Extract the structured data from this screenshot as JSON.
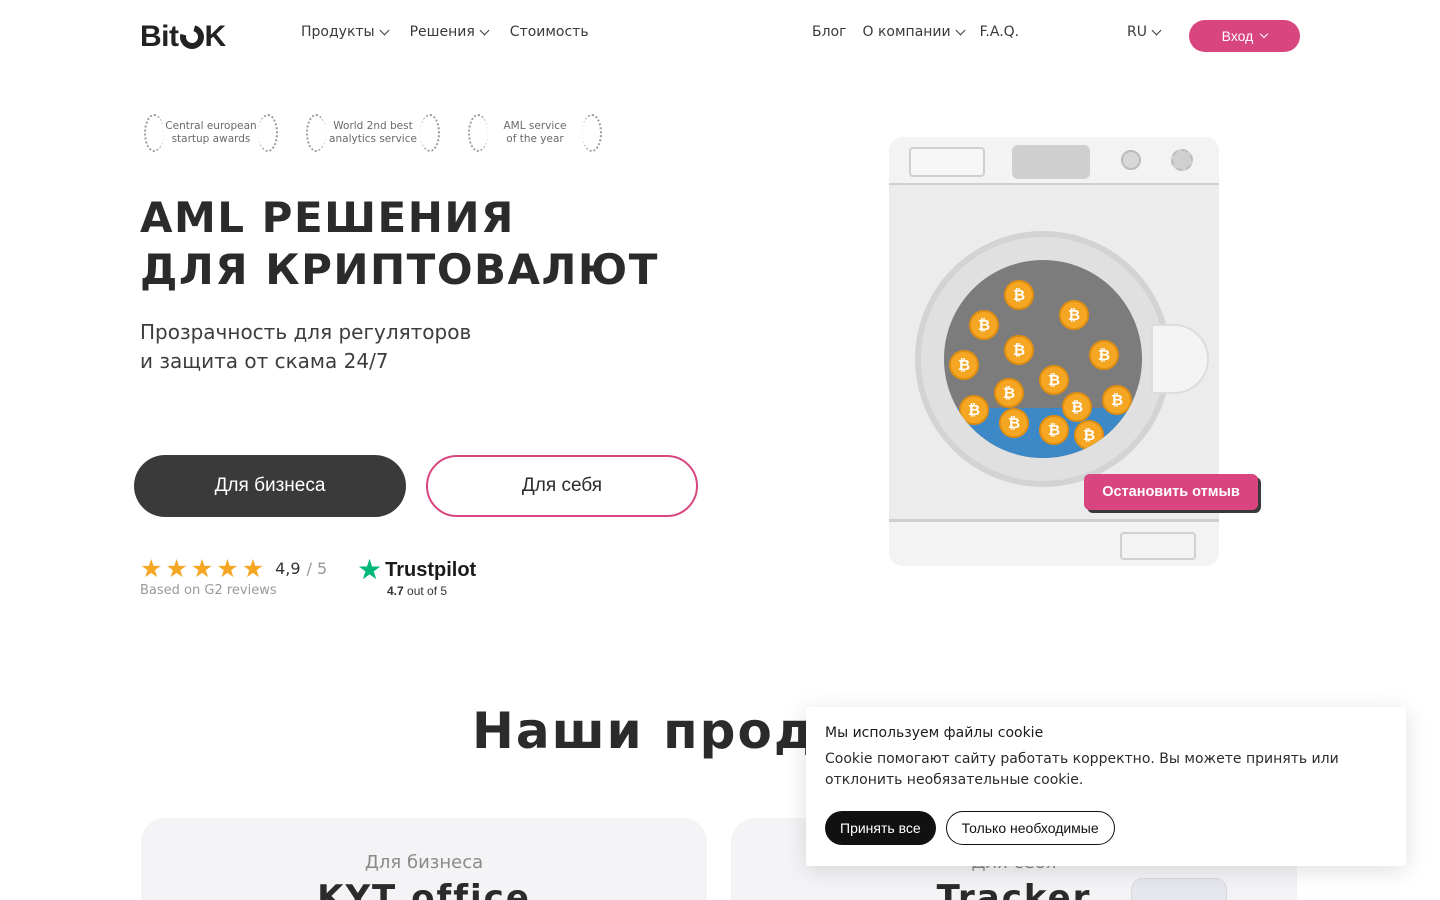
{
  "header": {
    "logo_left": "Bit",
    "logo_right": "K",
    "nav_left": [
      {
        "label": "Продукты",
        "dropdown": true
      },
      {
        "label": "Решения",
        "dropdown": true
      },
      {
        "label": "Стоимость",
        "dropdown": false
      }
    ],
    "nav_right": [
      {
        "label": "Блог",
        "dropdown": false
      },
      {
        "label": "О компании",
        "dropdown": true
      },
      {
        "label": "F.A.Q.",
        "dropdown": false
      }
    ],
    "lang": "RU",
    "login_label": "Вход"
  },
  "awards": [
    {
      "line1": "Central european",
      "line2": "startup awards"
    },
    {
      "line1": "World 2nd best",
      "line2": "analytics service"
    },
    {
      "line1": "AML service",
      "line2": "of the year"
    }
  ],
  "hero": {
    "title_line1": "AML РЕШЕНИЯ",
    "title_line2": "ДЛЯ КРИПТОВАЛЮТ",
    "subtitle_line1": "Прозрачность для регуляторов",
    "subtitle_line2": "и защита от скама 24/7",
    "btn_business": "Для бизнеса",
    "btn_self": "Для себя"
  },
  "ratings": {
    "g2_stars": 5,
    "g2_score": "4,9",
    "g2_max": "/ 5",
    "g2_caption": "Based on G2 reviews",
    "trustpilot_name": "Trustpilot",
    "trustpilot_score": "4.7",
    "trustpilot_caption": "out of 5"
  },
  "washer": {
    "stop_button": "Остановить отмыв",
    "coin_symbol": "₿"
  },
  "products": {
    "title": "Наши прод",
    "cards": [
      {
        "subtitle": "Для бизнеса",
        "title": "KYT office"
      },
      {
        "subtitle": "Для себя",
        "title": "Tracker"
      }
    ]
  },
  "cookie": {
    "title": "Мы используем файлы cookie",
    "text": "Cookie помогают сайту работать корректно. Вы можете принять или отклонить необязательные cookie.",
    "accept_label": "Принять все",
    "necessary_label": "Только необходимые"
  },
  "colors": {
    "accent": "#d8457f",
    "dark": "#3a3a3a",
    "star": "#f5a623",
    "trustpilot": "#00b67a"
  }
}
